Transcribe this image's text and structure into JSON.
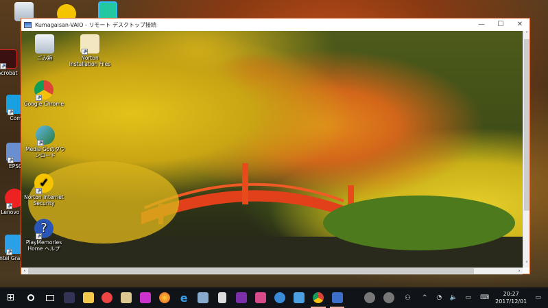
{
  "desktop": {
    "icons": [
      {
        "label": "Acrobat"
      },
      {
        "label": "Com"
      },
      {
        "label": "EPSO"
      },
      {
        "label": "Lenovo Ce"
      },
      {
        "label": "Intel Graphic"
      }
    ]
  },
  "window": {
    "title": "Kumagaisan-VAIO - リモート デスクトップ接続",
    "minimize": "—",
    "maximize": "☐",
    "close": "✕"
  },
  "remote_desktop": {
    "icons": [
      {
        "label": "ごみ箱"
      },
      {
        "label": "Norton Installation Files"
      },
      {
        "label": "Google Chrome"
      },
      {
        "label": "Media Goのダウンロード"
      },
      {
        "label": "Norton Internet Security"
      },
      {
        "label": "PlayMemories Home ヘルプ"
      }
    ]
  },
  "scroll": {
    "up": "˄",
    "down": "˅",
    "left": "‹",
    "right": "›"
  },
  "taskbar": {
    "apps": [
      "start",
      "search",
      "task-view",
      "app",
      "file-explorer",
      "app",
      "app",
      "app",
      "firefox",
      "internet-explorer",
      "app",
      "calculator",
      "onenote",
      "app",
      "app",
      "app",
      "chrome",
      "remote-desktop"
    ],
    "tray": {
      "chevron": "^",
      "volume": "🔈",
      "keyboard": "⌨",
      "notifications": "▭"
    },
    "time": "20:27",
    "date": "2017/12/01"
  }
}
